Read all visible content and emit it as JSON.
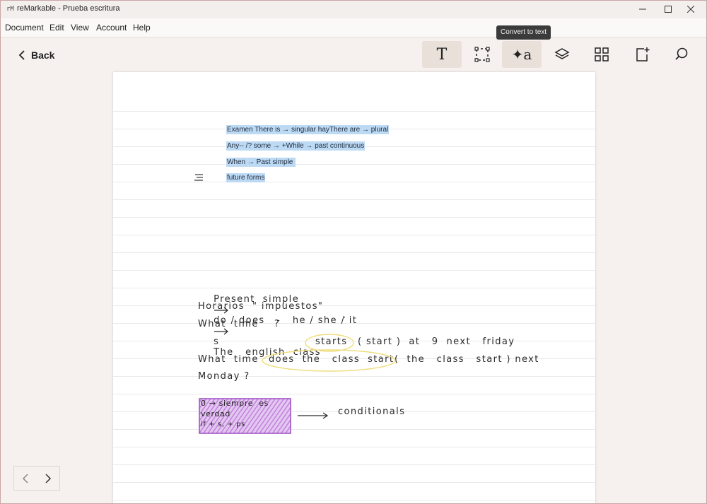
{
  "window": {
    "app_icon": "rM",
    "title": "reMarkable - Prueba escritura"
  },
  "menu": {
    "items": [
      "Document",
      "Edit",
      "View",
      "Account",
      "Help"
    ]
  },
  "toolbar": {
    "back_label": "Back",
    "text_tool_glyph": "T",
    "convert_tool_glyph": "✦a",
    "tooltip": "Convert to text",
    "icons": [
      "text-tool-icon",
      "selection-tool-icon",
      "convert-to-text-icon",
      "layers-icon",
      "page-overview-icon",
      "add-page-icon",
      "search-icon"
    ]
  },
  "page": {
    "typed_lines": [
      "Examen There is → singular hayThere are → plural",
      "Any-- /? some → +While → past continuous",
      "When → Past simple ",
      "future forms"
    ],
    "handwriting": {
      "line1": "Present  simple",
      "line1b": "do / does   -   he / she / it",
      "line1c": "s",
      "line2": "Horarios  \" impuestos\"",
      "line3": "What  time    ?",
      "line4a": "The   english  class",
      "line4_circled": "starts",
      "line4b": "( start )  at   9  next   friday",
      "line5a": "What  time",
      "line5_circled": "does  the   class  start",
      "line5b": "(  the   class   start ) next",
      "line6": "Monday ?",
      "box_line1": "0 → siempre  es",
      "box_line2": "verdad",
      "box_line3": "if + s, + ps",
      "conditionals": "conditionals"
    }
  },
  "colors": {
    "highlight_blue": "#bddaf5",
    "circle_yellow": "#f0dc7a",
    "box_purple": "#b46ad6"
  }
}
